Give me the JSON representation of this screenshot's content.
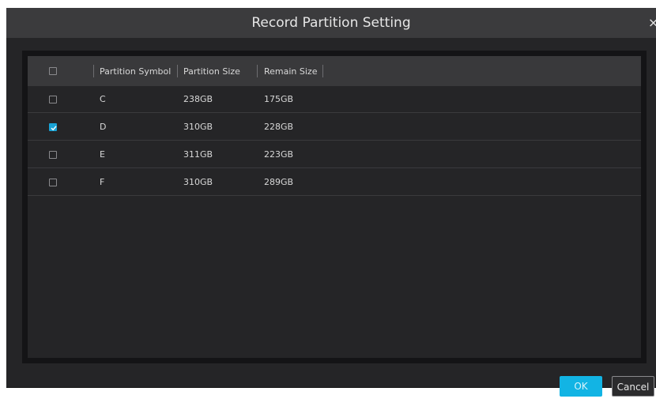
{
  "dialog": {
    "title": "Record Partition Setting",
    "close_glyph": "×"
  },
  "table": {
    "headers": [
      "Partition Symbol",
      "Partition Size",
      "Remain Size"
    ],
    "header_checkbox_checked": false,
    "rows": [
      {
        "checked": false,
        "symbol": "C",
        "size": "238GB",
        "remain": "175GB"
      },
      {
        "checked": true,
        "symbol": "D",
        "size": "310GB",
        "remain": "228GB"
      },
      {
        "checked": false,
        "symbol": "E",
        "size": "311GB",
        "remain": "223GB"
      },
      {
        "checked": false,
        "symbol": "F",
        "size": "310GB",
        "remain": "289GB"
      }
    ]
  },
  "buttons": {
    "ok_label": "OK",
    "cancel_label": "Cancel"
  },
  "colors": {
    "accent": "#12b4e4",
    "panel": "#252527",
    "titlebar": "#3b3b3d"
  }
}
